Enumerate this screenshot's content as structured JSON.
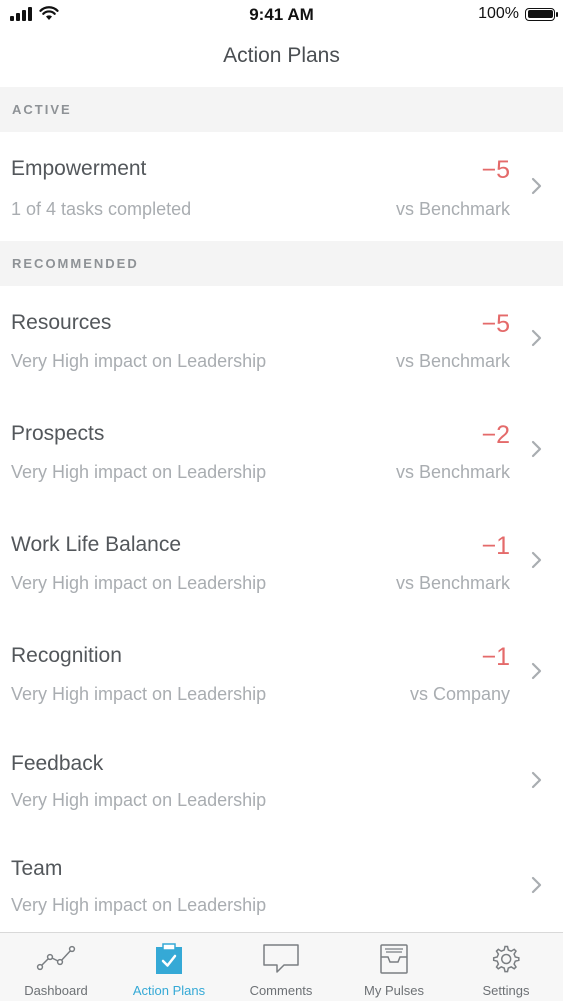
{
  "status_bar": {
    "time": "9:41 AM",
    "battery": "100%"
  },
  "nav": {
    "title": "Action Plans"
  },
  "sections": {
    "active": {
      "header": "ACTIVE"
    },
    "recommended": {
      "header": "RECOMMENDED"
    }
  },
  "active_items": [
    {
      "title": "Empowerment",
      "subtitle": "1 of 4 tasks completed",
      "score": "−5",
      "comparison": "vs Benchmark"
    }
  ],
  "recommended_items": [
    {
      "title": "Resources",
      "subtitle": "Very High impact on Leadership",
      "score": "−5",
      "comparison": "vs Benchmark"
    },
    {
      "title": "Prospects",
      "subtitle": "Very High impact on Leadership",
      "score": "−2",
      "comparison": "vs Benchmark"
    },
    {
      "title": "Work Life Balance",
      "subtitle": "Very High impact on Leadership",
      "score": "−1",
      "comparison": "vs Benchmark"
    },
    {
      "title": "Recognition",
      "subtitle": "Very High impact on Leadership",
      "score": "−1",
      "comparison": "vs Company"
    },
    {
      "title": "Feedback",
      "subtitle": "Very High impact on Leadership"
    },
    {
      "title": "Team",
      "subtitle": "Very High impact on Leadership"
    }
  ],
  "tab_bar": {
    "tabs": [
      {
        "label": "Dashboard",
        "icon": "line-chart-icon"
      },
      {
        "label": "Action Plans",
        "icon": "clipboard-check-icon",
        "active": true
      },
      {
        "label": "Comments",
        "icon": "speech-bubble-icon"
      },
      {
        "label": "My Pulses",
        "icon": "inbox-tray-icon"
      },
      {
        "label": "Settings",
        "icon": "gear-icon"
      }
    ]
  },
  "colors": {
    "accent": "#35a9d6",
    "negative": "#e46a6a",
    "section_bg": "#f4f4f4"
  }
}
